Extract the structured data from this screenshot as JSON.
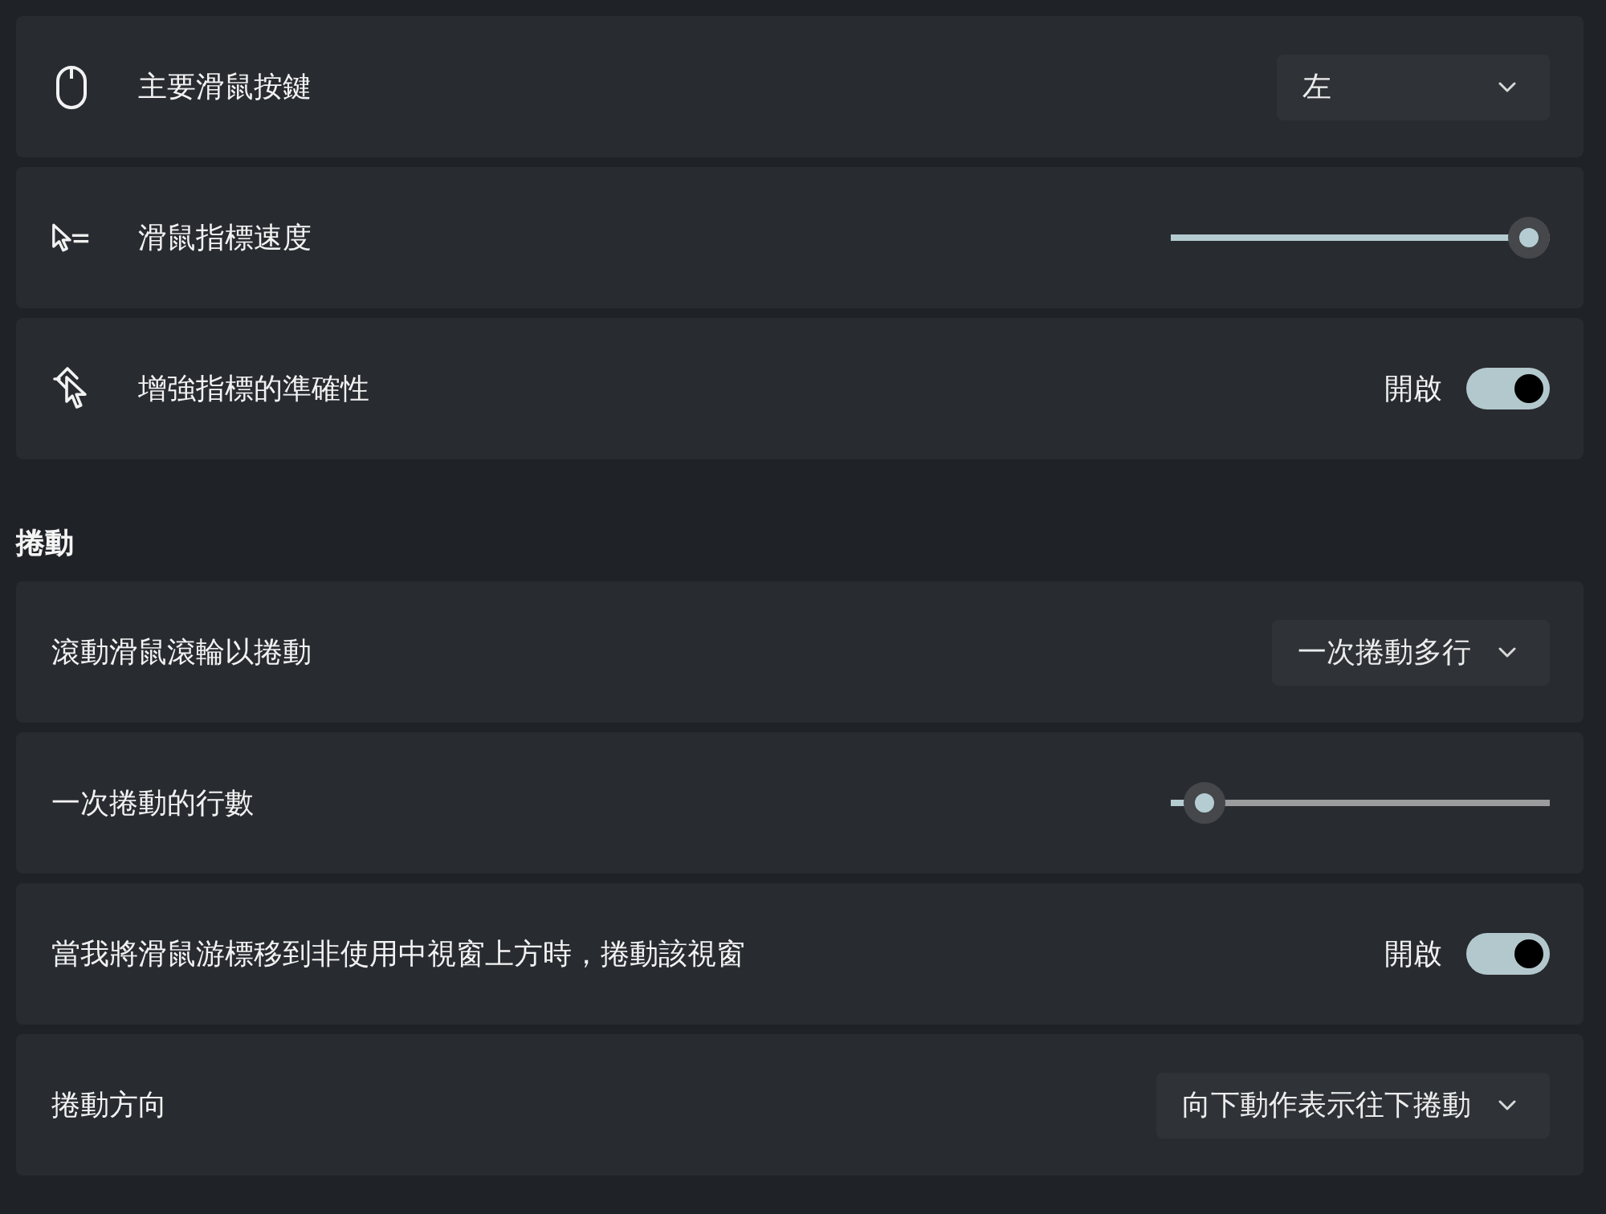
{
  "sections": [
    {
      "settings": [
        {
          "kind": "dropdown",
          "label": "主要滑鼠按鍵",
          "value": "左"
        },
        {
          "kind": "slider",
          "label": "滑鼠指標速度",
          "level": 1.0
        },
        {
          "kind": "toggle",
          "label": "增強指標的準確性",
          "on": true,
          "state_label": "開啟"
        }
      ]
    },
    {
      "heading": "捲動",
      "settings": [
        {
          "kind": "dropdown",
          "label": "滾動滑鼠滾輪以捲動",
          "value": "一次捲動多行"
        },
        {
          "kind": "slider",
          "label": "一次捲動的行數",
          "level": 0.04
        },
        {
          "kind": "toggle",
          "label": "當我將滑鼠游標移到非使用中視窗上方時，捲動該視窗",
          "on": true,
          "state_label": "開啟"
        },
        {
          "kind": "dropdown",
          "label": "捲動方向",
          "value": "向下動作表示往下捲動"
        }
      ]
    }
  ]
}
